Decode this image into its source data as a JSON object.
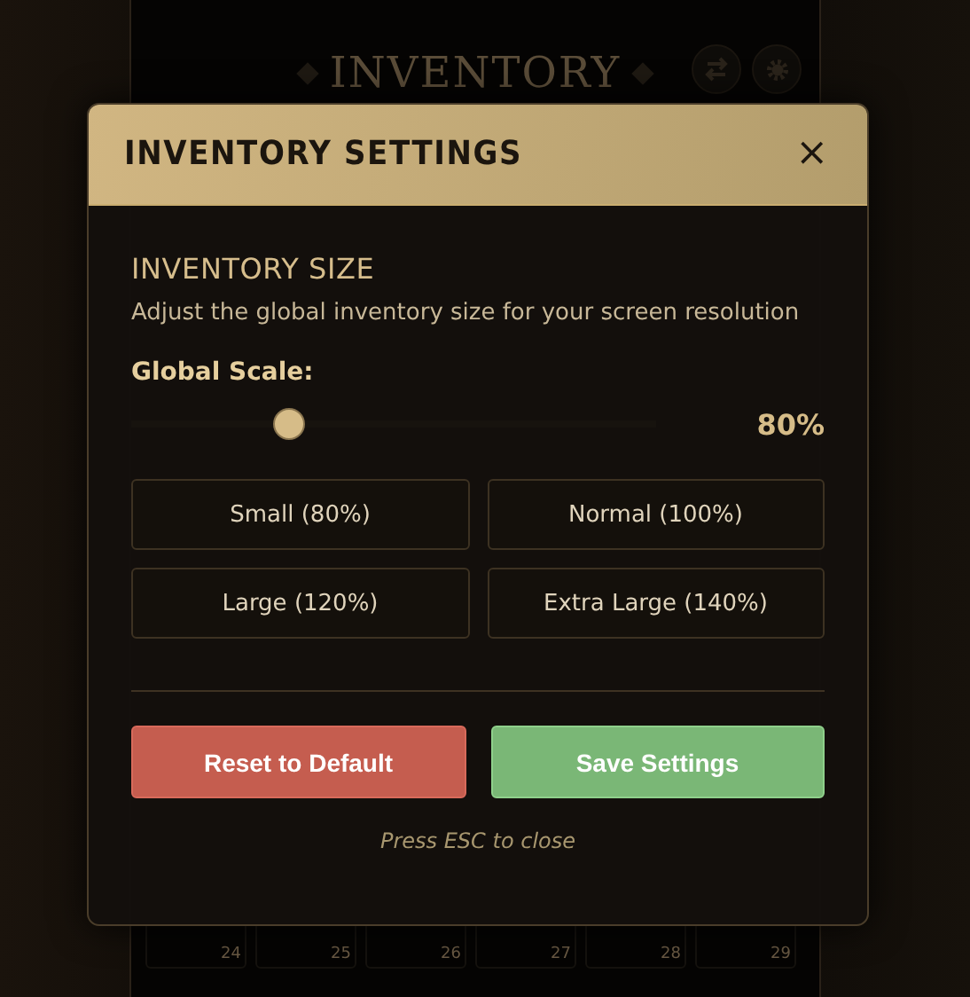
{
  "background": {
    "title": "INVENTORY",
    "slot_numbers": [
      "24",
      "25",
      "26",
      "27",
      "28",
      "29"
    ]
  },
  "dialog": {
    "title": "INVENTORY SETTINGS",
    "close": "×",
    "section_title": "INVENTORY SIZE",
    "description": "Adjust the global inventory size for your screen resolution",
    "scale_label": "Global Scale:",
    "scale": {
      "level": 0.3,
      "reading": "80%"
    },
    "presets": [
      "Small (80%)",
      "Normal (100%)",
      "Large (120%)",
      "Extra Large (140%)"
    ],
    "buttons": [
      {
        "kind": "reset",
        "label": "Reset to Default"
      },
      {
        "kind": "save",
        "label": "Save Settings"
      }
    ],
    "hint": "Press ESC to close"
  }
}
